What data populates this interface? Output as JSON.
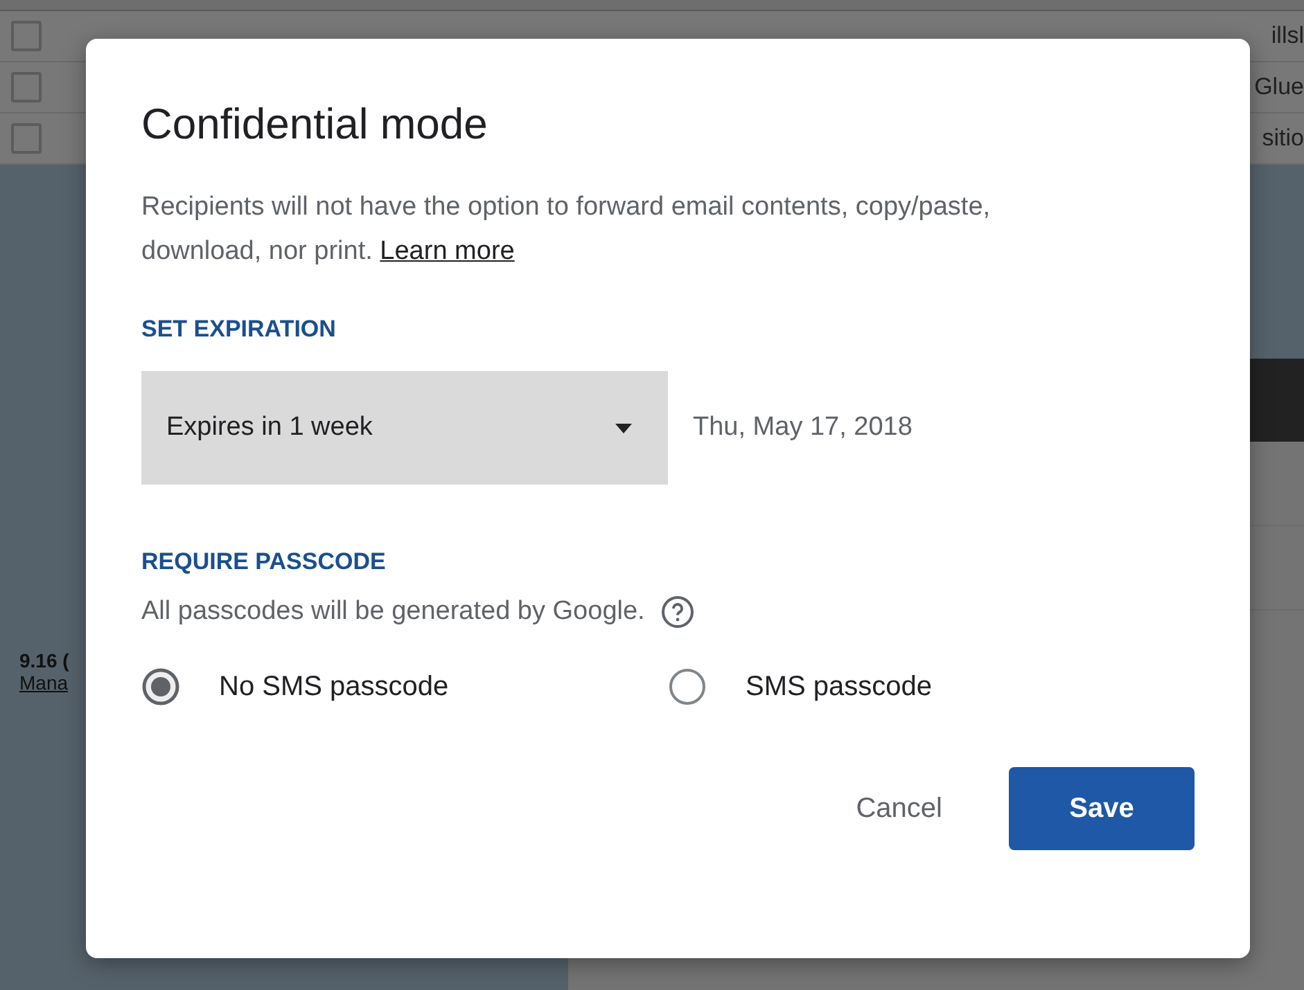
{
  "background": {
    "rows": [
      {
        "snippet": "illsl",
        "checked": false
      },
      {
        "snippet": "Glue",
        "checked": false
      },
      {
        "snippet": "sitio",
        "checked": false
      }
    ],
    "side_note": {
      "title": "9.16 (",
      "link": "Mana"
    }
  },
  "dialog": {
    "title": "Confidential mode",
    "description": "Recipients will not have the option to forward email contents, copy/paste, download, nor print.",
    "learn_more": "Learn more",
    "expiration": {
      "heading": "SET EXPIRATION",
      "dropdown": "Expires in 1 week",
      "date": "Thu, May 17, 2018"
    },
    "passcode": {
      "heading": "REQUIRE PASSCODE",
      "note": "All passcodes will be generated by Google.",
      "options": [
        {
          "label": "No SMS passcode",
          "selected": true
        },
        {
          "label": "SMS passcode",
          "selected": false
        }
      ]
    },
    "buttons": [
      {
        "label": "Cancel",
        "kind": "text"
      },
      {
        "label": "Save",
        "kind": "primary"
      }
    ]
  }
}
